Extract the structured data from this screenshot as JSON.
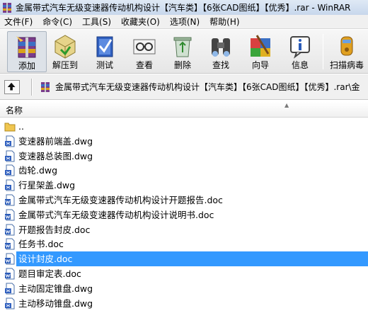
{
  "window": {
    "title": "金属带式汽车无级变速器传动机构设计【汽车类】【6张CAD图纸】【优秀】.rar - WinRAR"
  },
  "menu": [
    "文件(F)",
    "命令(C)",
    "工具(S)",
    "收藏夹(O)",
    "选项(N)",
    "帮助(H)"
  ],
  "toolbar": {
    "add": "添加",
    "extract": "解压到",
    "test": "测试",
    "view": "查看",
    "delete": "删除",
    "find": "查找",
    "wizard": "向导",
    "info": "信息",
    "virus": "扫描病毒"
  },
  "address": {
    "path": "金属带式汽车无级变速器传动机构设计【汽车类】【6张CAD图纸】【优秀】.rar\\金"
  },
  "list": {
    "column_name": "名称",
    "files": [
      {
        "name": "..",
        "icon": "folder-icon"
      },
      {
        "name": "变速器前端盖.dwg",
        "icon": "dwg-file-icon"
      },
      {
        "name": "变速器总装图.dwg",
        "icon": "dwg-file-icon"
      },
      {
        "name": "齿轮.dwg",
        "icon": "dwg-file-icon"
      },
      {
        "name": "行星架盖.dwg",
        "icon": "dwg-file-icon"
      },
      {
        "name": "金属带式汽车无级变速器传动机构设计开题报告.doc",
        "icon": "doc-file-icon"
      },
      {
        "name": "金属带式汽车无级变速器传动机构设计说明书.doc",
        "icon": "doc-file-icon"
      },
      {
        "name": "开题报告封皮.doc",
        "icon": "doc-file-icon"
      },
      {
        "name": "任务书.doc",
        "icon": "doc-file-icon"
      },
      {
        "name": "设计封皮.doc",
        "icon": "doc-file-icon",
        "selected": true
      },
      {
        "name": "题目审定表.doc",
        "icon": "doc-file-icon"
      },
      {
        "name": "主动固定锥盘.dwg",
        "icon": "dwg-file-icon"
      },
      {
        "name": "主动移动锥盘.dwg",
        "icon": "dwg-file-icon"
      }
    ]
  }
}
